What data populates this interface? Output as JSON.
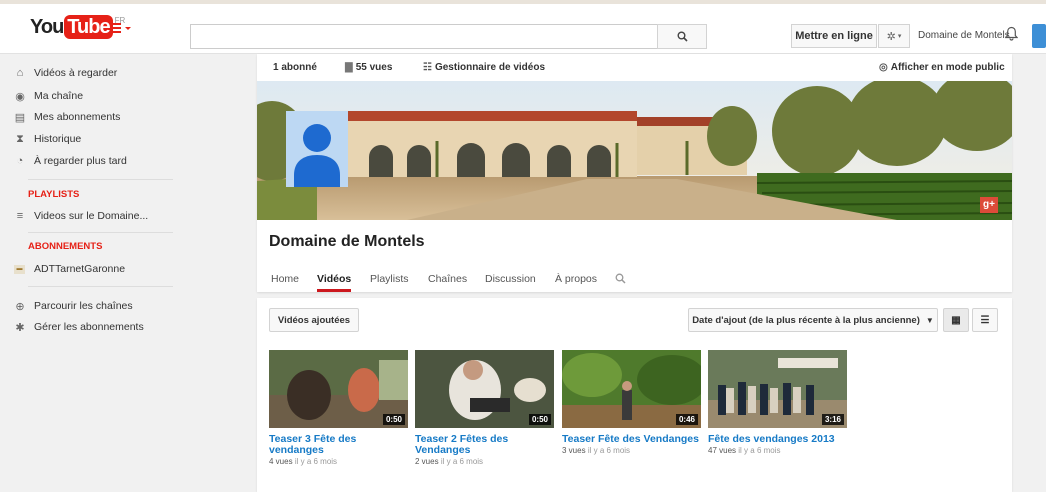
{
  "masthead": {
    "logo_you": "You",
    "logo_tube": "Tube",
    "logo_region": "FR",
    "search_placeholder": "",
    "upload_label": "Mettre en ligne",
    "user_name": "Domaine de Montels"
  },
  "guide": {
    "main_items": [
      {
        "label": "Vidéos à regarder",
        "icon": "home-icon"
      },
      {
        "label": "Ma chaîne",
        "icon": "user-icon"
      },
      {
        "label": "Mes abonnements",
        "icon": "subscriptions-icon"
      },
      {
        "label": "Historique",
        "icon": "hourglass-icon"
      },
      {
        "label": "À regarder plus tard",
        "icon": "clock-icon"
      }
    ],
    "playlists_title": "PLAYLISTS",
    "playlists": [
      {
        "label": "Videos sur le Domaine...",
        "icon": "list-icon"
      }
    ],
    "subscriptions_title": "ABONNEMENTS",
    "subscriptions": [
      {
        "label": "ADTTarnetGaronne",
        "icon": "channel-thumb-icon"
      }
    ],
    "footer_items": [
      {
        "label": "Parcourir les chaînes",
        "icon": "plus-circle-icon"
      },
      {
        "label": "Gérer les abonnements",
        "icon": "gear-icon"
      }
    ]
  },
  "channel": {
    "subscribers": "1 abonné",
    "views": "55 vues",
    "video_manager": "Gestionnaire de vidéos",
    "public_view": "Afficher en mode public",
    "title": "Domaine de Montels",
    "tabs": [
      "Home",
      "Vidéos",
      "Playlists",
      "Chaînes",
      "Discussion",
      "À propos"
    ],
    "active_tab": "Vidéos"
  },
  "videos_section": {
    "filter_label": "Vidéos ajoutées",
    "sort_label": "Date d'ajout (de la plus récente à la plus ancienne)",
    "videos": [
      {
        "title": "Teaser 3 Fête des vendanges",
        "duration": "0:50",
        "views": "4 vues",
        "age": "il y a 6 mois"
      },
      {
        "title": "Teaser 2 Fêtes des Vendanges",
        "duration": "0:50",
        "views": "2 vues",
        "age": "il y a 6 mois"
      },
      {
        "title": "Teaser Fête des Vendanges",
        "duration": "0:46",
        "views": "3 vues",
        "age": "il y a 6 mois"
      },
      {
        "title": "Fête des vendanges 2013",
        "duration": "3:16",
        "views": "47 vues",
        "age": "il y a 6 mois"
      }
    ]
  },
  "colors": {
    "brand_red": "#e62117",
    "link_blue": "#167ac6",
    "tab_underline": "#cc181e"
  }
}
